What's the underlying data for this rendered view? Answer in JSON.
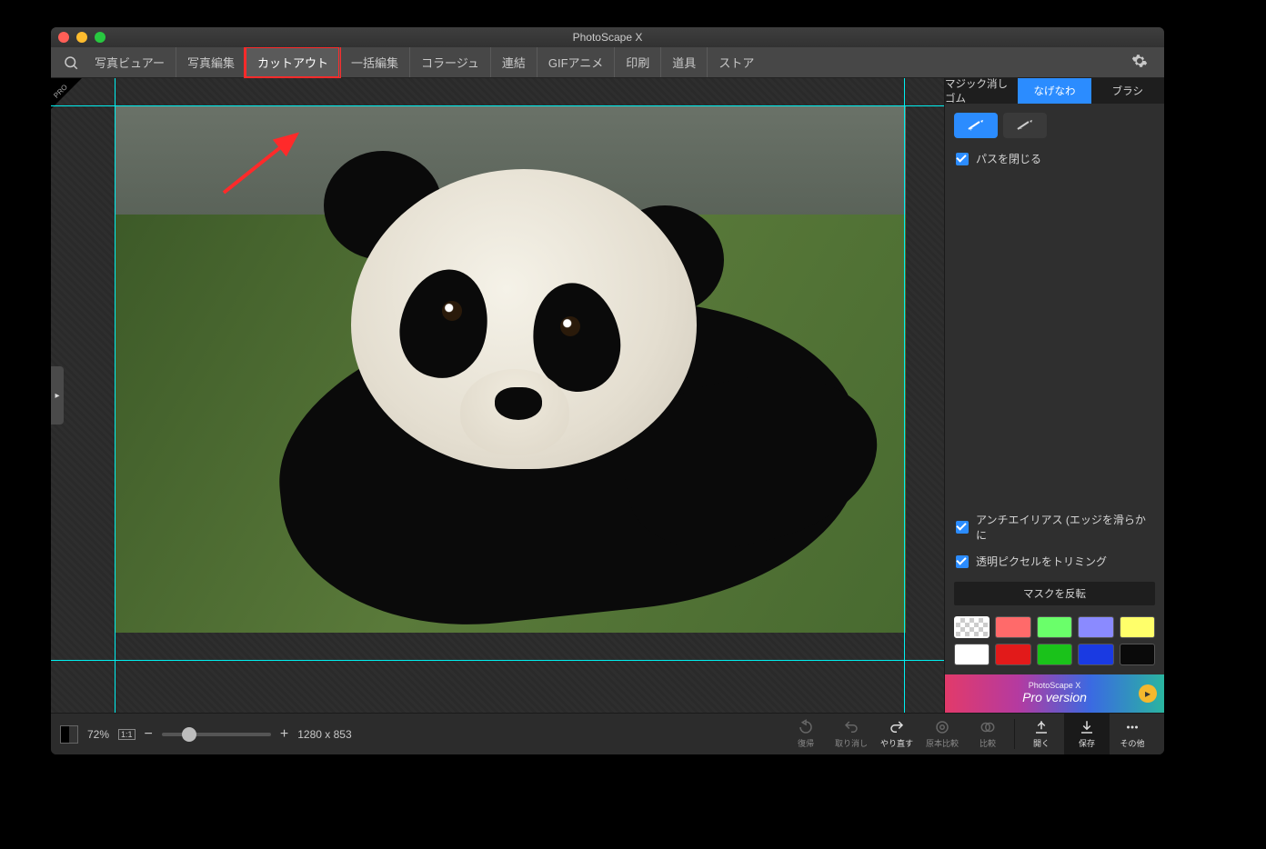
{
  "window": {
    "title": "PhotoScape X"
  },
  "tabs": [
    {
      "label": "写真ビュアー"
    },
    {
      "label": "写真編集"
    },
    {
      "label": "カットアウト",
      "active": true,
      "highlight": true
    },
    {
      "label": "一括編集"
    },
    {
      "label": "コラージュ"
    },
    {
      "label": "連結"
    },
    {
      "label": "GIFアニメ"
    },
    {
      "label": "印刷"
    },
    {
      "label": "道具"
    },
    {
      "label": "ストア"
    }
  ],
  "pro_badge": "PRO",
  "sidepanel": {
    "tool_tabs": [
      {
        "label": "マジック消しゴム"
      },
      {
        "label": "なげなわ",
        "active": true
      },
      {
        "label": "ブラシ"
      }
    ],
    "close_path_label": "パスを閉じる",
    "antialias_label": "アンチエイリアス (エッジを滑らかに",
    "trim_transparent_label": "透明ピクセルをトリミング",
    "invert_mask_label": "マスクを反転",
    "swatches_top": [
      "checker",
      "#ff6a6a",
      "#6aff6a",
      "#8a8aff",
      "#ffff6a"
    ],
    "swatches_bottom": [
      "#ffffff",
      "#e21a1a",
      "#1ac21a",
      "#1a3ae2",
      "#0a0a0a"
    ],
    "promo_line1": "PhotoScape X",
    "promo_line2": "Pro version"
  },
  "footer": {
    "zoom": "72%",
    "one_to_one": "1:1",
    "dimensions": "1280 x 853",
    "actions": {
      "restore": "復帰",
      "undo": "取り消し",
      "redo": "やり直す",
      "orig_compare": "原本比較",
      "compare": "比較",
      "open": "開く",
      "save": "保存",
      "more": "その他"
    }
  }
}
